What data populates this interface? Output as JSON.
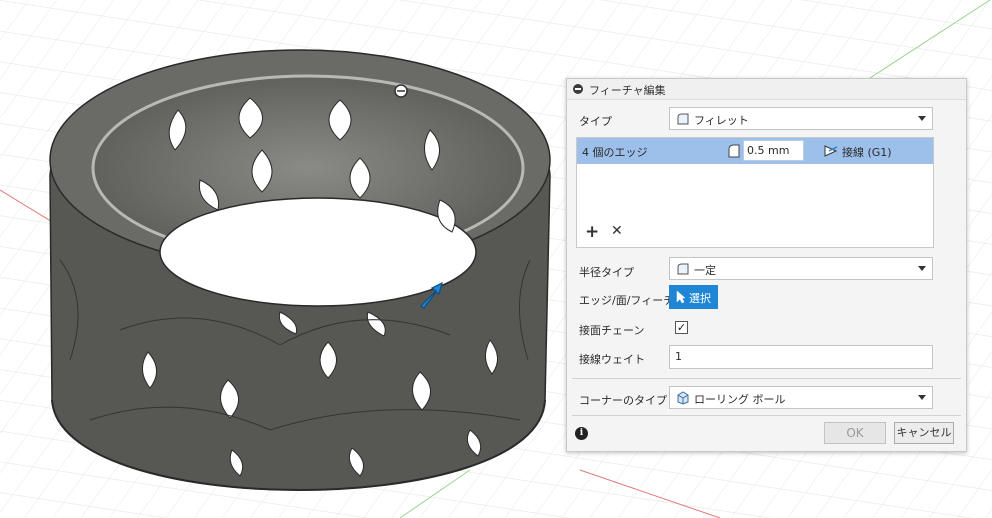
{
  "colors": {
    "accent": "#1f86d6",
    "selected_row": "#9cc0ea",
    "grid_red": "#e07a7a",
    "grid_green": "#9bd48f",
    "model_dark": "#4a4a48"
  },
  "dialog": {
    "title": "フィーチャ編集",
    "collapse_icon": "minus-circle-icon",
    "type": {
      "label": "タイプ",
      "value": "フィレット",
      "icon": "fillet-icon"
    },
    "edges": {
      "row_label": "4 個のエッジ",
      "radius_value": "0.5 mm",
      "continuity": "接線 (G1)",
      "radius_icon": "fillet-radius-icon",
      "continuity_icon": "tangent-icon",
      "add_icon": "plus-icon",
      "remove_icon": "close-icon"
    },
    "radius_type": {
      "label": "半径タイプ",
      "value": "一定",
      "icon": "constant-radius-icon"
    },
    "edge_face_feature": {
      "label": "エッジ/面/フィーチャ",
      "button_label": "選択",
      "icon": "cursor-arrow-icon"
    },
    "tangent_chain": {
      "label": "接面チェーン",
      "checked": true
    },
    "tangent_weight": {
      "label": "接線ウェイト",
      "value": "1"
    },
    "corner_type": {
      "label": "コーナーのタイプ",
      "value": "ローリング ボール",
      "icon": "rolling-ball-icon"
    },
    "info_icon": "info-icon",
    "ok_label": "OK",
    "cancel_label": "キャンセル"
  }
}
